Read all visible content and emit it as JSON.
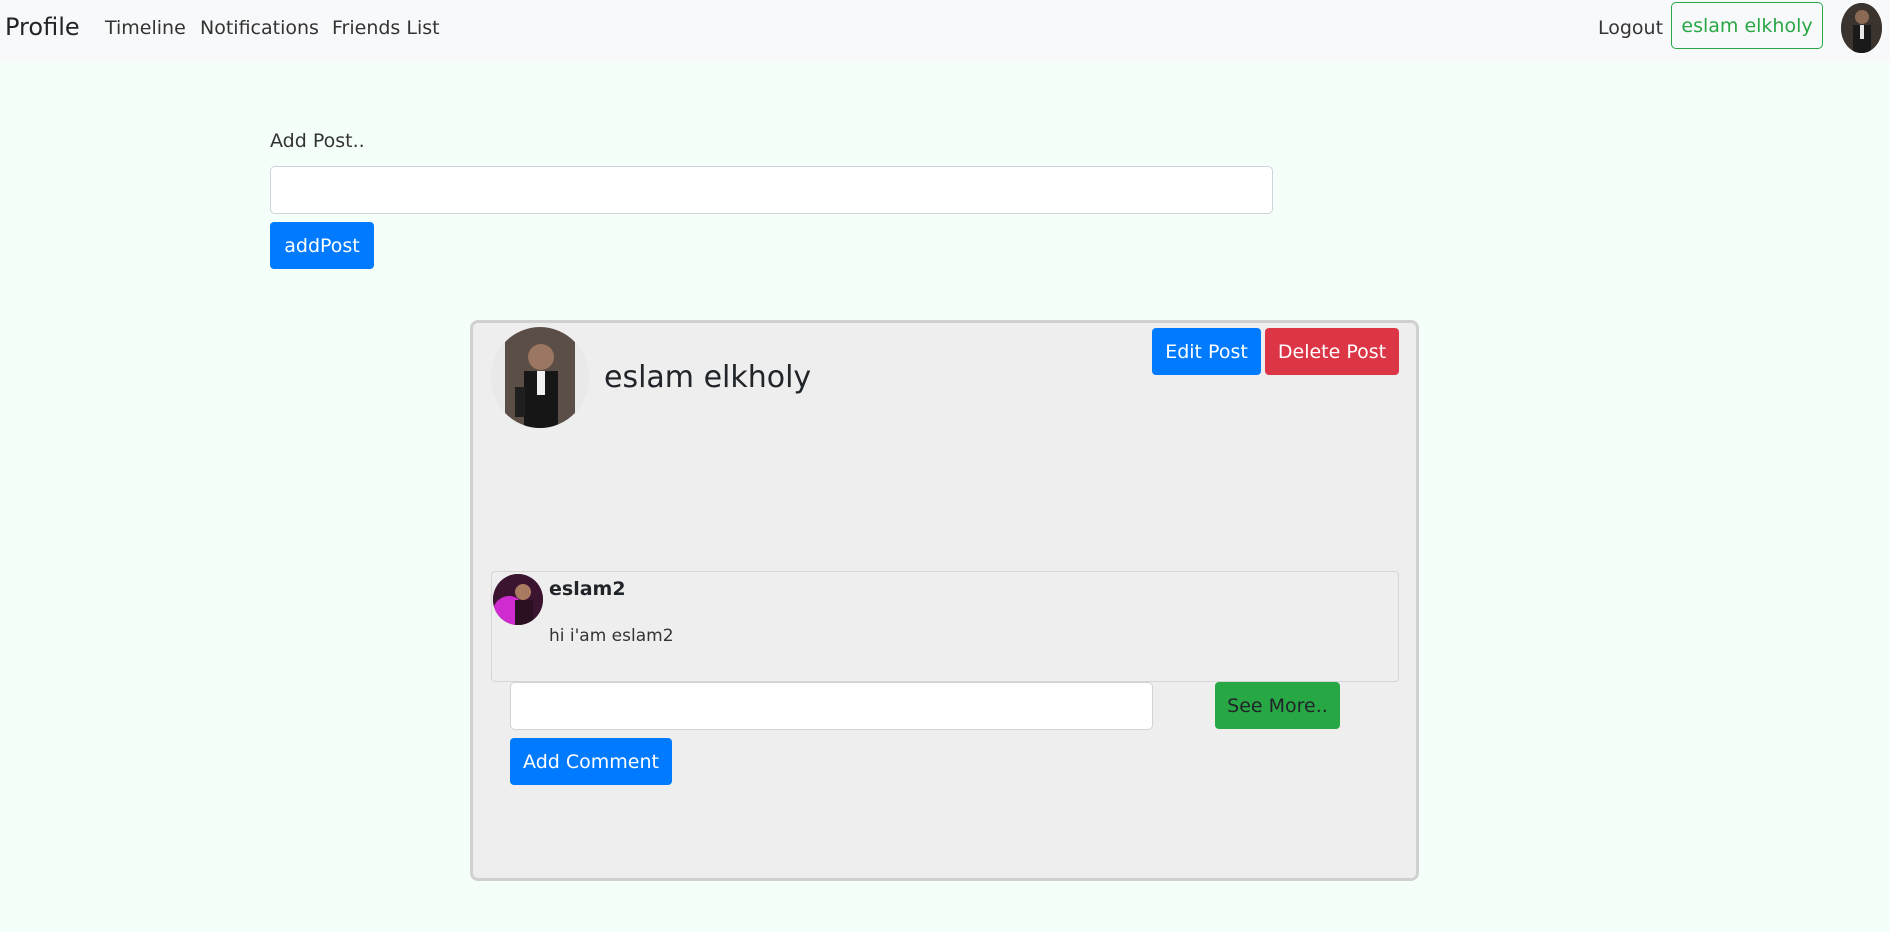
{
  "navbar": {
    "brand": "Profile",
    "links": [
      "Timeline",
      "Notifications",
      "Friends List"
    ],
    "logout": "Logout",
    "user_button": "eslam elkholy"
  },
  "add_post": {
    "label": "Add Post..",
    "input_value": "",
    "button": "addPost"
  },
  "post": {
    "author": "eslam elkholy",
    "edit_button": "Edit Post",
    "delete_button": "Delete Post",
    "comment": {
      "author": "eslam2",
      "text": "hi i'am eslam2"
    },
    "comment_input_value": "",
    "see_more_button": "See More..",
    "add_comment_button": "Add Comment"
  },
  "colors": {
    "primary": "#007bff",
    "danger": "#dc3545",
    "success": "#28a745",
    "page_bg": "#f5fff9"
  }
}
